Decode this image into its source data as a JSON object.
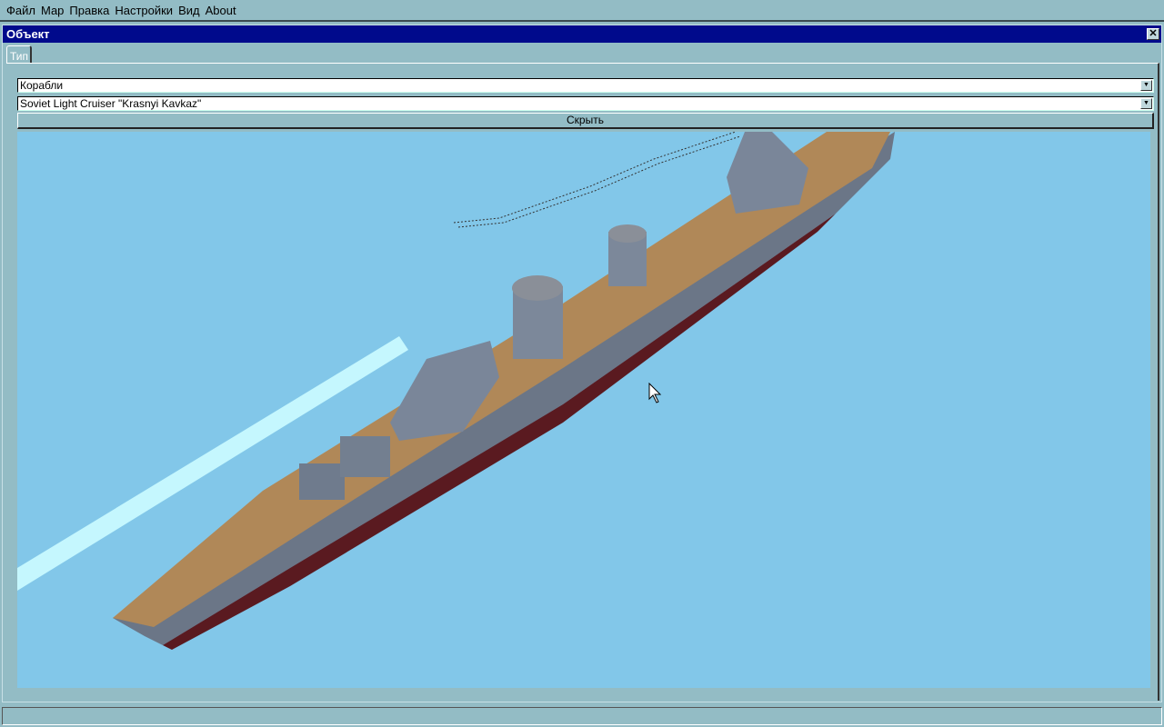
{
  "menu": {
    "items": [
      "Файл",
      "Мар",
      "Правка",
      "Настройки",
      "Вид",
      "About"
    ]
  },
  "window": {
    "title": "Объект",
    "close_icon": "close-icon"
  },
  "tabs": [
    {
      "label": "Тип"
    }
  ],
  "form": {
    "category": "Корабли",
    "object": "Soviet Light Cruiser \"Krasnyi Kavkaz\"",
    "hide_label": "Скрыть"
  },
  "colors": {
    "title_bar": "#000a8c",
    "viewport": "#82c7e9",
    "deck": "#b08858",
    "hull": "#6a7888"
  }
}
